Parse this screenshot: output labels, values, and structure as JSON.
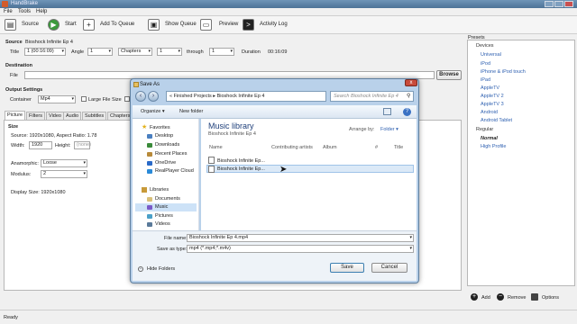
{
  "app": {
    "title": "HandBrake"
  },
  "menu": {
    "file": "File",
    "tools": "Tools",
    "help": "Help"
  },
  "toolbar": {
    "source": "Source",
    "start": "Start",
    "add_to_queue": "Add To Queue",
    "show_queue": "Show Queue",
    "preview": "Preview",
    "activity_log": "Activity Log"
  },
  "source_section": {
    "heading": "Source",
    "source_name": "Bioshock Infinite Ep 4",
    "title_label": "Title",
    "title_value": "1 (00:16:09)",
    "angle_label": "Angle",
    "angle_value": "1",
    "chapters_value": "Chapters",
    "chapter_from": "1",
    "through_label": "through",
    "chapter_to": "1",
    "duration_label": "Duration",
    "duration_value": "00:16:09"
  },
  "destination": {
    "heading": "Destination",
    "file_label": "File",
    "browse": "Browse"
  },
  "output": {
    "heading": "Output Settings",
    "container_label": "Container",
    "container_value": "Mp4",
    "large_file": "Large File Size",
    "web_optimized": "W"
  },
  "tabs": [
    "Picture",
    "Filters",
    "Video",
    "Audio",
    "Subtitles",
    "Chapters"
  ],
  "picture": {
    "size_heading": "Size",
    "source_info": "Source:  1920x1080, Aspect Ratio: 1.78",
    "width_label": "Width:",
    "width_value": "1920",
    "height_label": "Height:",
    "height_value": "(none)",
    "anamorphic_label": "Anamorphic:",
    "anamorphic_value": "Loose",
    "modulus_label": "Modulus:",
    "modulus_value": "2",
    "display_size": "Display Size:  1920x1080"
  },
  "presets": {
    "heading": "Presets",
    "devices_group": "Devices",
    "devices": [
      "Universal",
      "iPod",
      "iPhone & iPod touch",
      "iPad",
      "AppleTV",
      "AppleTV 2",
      "AppleTV 3",
      "Android",
      "Android Tablet"
    ],
    "regular_group": "Regular",
    "regular": [
      "Normal",
      "High Profile"
    ],
    "add": "Add",
    "remove": "Remove",
    "options": "Options"
  },
  "status": {
    "text": "Ready"
  },
  "dialog": {
    "title": "Save As",
    "breadcrumb": "«  Finished Projects  ▸  Bioshock Infinite Ep 4",
    "search_placeholder": "Search Bioshock Infinite Ep 4",
    "organize": "Organize ▾",
    "new_folder": "New folder",
    "favorites": "Favorites",
    "fav_items": [
      "Desktop",
      "Downloads",
      "Recent Places",
      "OneDrive",
      "RealPlayer Cloud"
    ],
    "libraries": "Libraries",
    "lib_items": [
      "Documents",
      "Music",
      "Pictures",
      "Videos"
    ],
    "library_title": "Music library",
    "library_sub": "Bioshock Infinite Ep 4",
    "arrange_label": "Arrange by:",
    "arrange_value": "Folder ▾",
    "col_name": "Name",
    "col_artists": "Contributing artists",
    "col_album": "Album",
    "col_num": "#",
    "col_title": "Title",
    "files": [
      "Bioshock Infinite Ep...",
      "Bioshock Infinite Ep..."
    ],
    "filename_label": "File name:",
    "filename_value": "Bioshock Infinite Ep 4.mp4",
    "savetype_label": "Save as type:",
    "savetype_value": "mp4 (*.mp4;*.m4v)",
    "hide_folders": "Hide Folders",
    "save": "Save",
    "cancel": "Cancel"
  },
  "colors": {
    "accent": "#2d5fb0",
    "dialog_frame": "#b9d1ea",
    "selection": "#cde2f7"
  }
}
